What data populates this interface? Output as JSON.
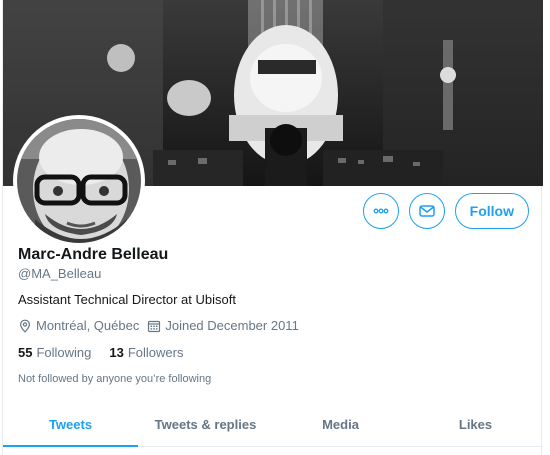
{
  "profile": {
    "name": "Marc-Andre Belleau",
    "handle": "@MA_Belleau",
    "bio": "Assistant Technical Director at Ubisoft",
    "location": "Montréal, Québec",
    "joined": "Joined December 2011",
    "following_count": "55",
    "following_label": "Following",
    "followers_count": "13",
    "followers_label": "Followers",
    "not_followed_text": "Not followed by anyone you’re following"
  },
  "actions": {
    "more_icon": "more-icon",
    "message_icon": "mail-icon",
    "follow_label": "Follow"
  },
  "tabs": [
    {
      "label": "Tweets",
      "active": true
    },
    {
      "label": "Tweets & replies",
      "active": false
    },
    {
      "label": "Media",
      "active": false
    },
    {
      "label": "Likes",
      "active": false
    }
  ],
  "colors": {
    "accent": "#1da1f2",
    "secondary_text": "#657786",
    "primary_text": "#14171a",
    "border": "#e6ecf0"
  }
}
